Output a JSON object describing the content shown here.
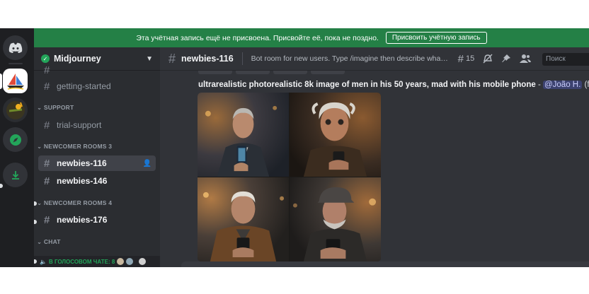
{
  "banner": {
    "text": "Эта учётная запись ещё не присвоена. Присвойте её, пока не поздно.",
    "button": "Присвоить учётную запись"
  },
  "server": {
    "name": "Midjourney"
  },
  "sidebar": {
    "channels_top": [
      {
        "label": "getting-started"
      }
    ],
    "categories": [
      {
        "label": "SUPPORT"
      },
      {
        "label": "NEWCOMER ROOMS 3"
      },
      {
        "label": "NEWCOMER ROOMS 4"
      },
      {
        "label": "CHAT"
      }
    ],
    "support_channel": "trial-support",
    "rooms3": [
      {
        "label": "newbies-116"
      },
      {
        "label": "newbies-146"
      }
    ],
    "rooms4": [
      {
        "label": "newbies-176"
      }
    ],
    "voice_status": "В ГОЛОСОВОМ ЧАТЕ: 8"
  },
  "channel": {
    "name": "newbies-116",
    "topic": "Bot room for new users. Type /imagine then describe what y...",
    "threads_count": "15",
    "search_placeholder": "Поиск"
  },
  "message": {
    "prompt": "ultrarealistic photorealistic 8k image of men in his 50 years, mad with his mobile phone",
    "separator": " - ",
    "mention": "@João H.",
    "speed": " (fast)"
  },
  "icons": {
    "rail": [
      "discord-icon",
      "midjourney-server-icon",
      "server-icon",
      "explore-icon",
      "download-icon"
    ],
    "toolbar": [
      "threads-icon",
      "mute-icon",
      "pin-icon",
      "members-icon"
    ]
  },
  "colors": {
    "banner": "#248046",
    "sidebar": "#2b2d31",
    "main": "#313338",
    "rail": "#1e1f22",
    "mention": "#3c4270"
  }
}
